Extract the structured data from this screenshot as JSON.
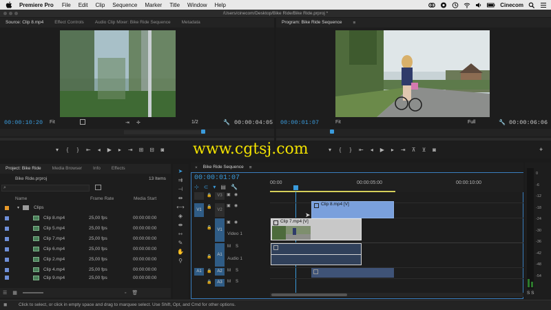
{
  "menubar": {
    "app_name": "Premiere Pro",
    "menus": [
      "File",
      "Edit",
      "Clip",
      "Sequence",
      "Marker",
      "Title",
      "Window",
      "Help"
    ],
    "user": "Cinecom"
  },
  "window": {
    "title": "/Users/cinecom/Desktop/Bike Ride/Bike Ride.prproj *"
  },
  "source_panel": {
    "tabs": [
      "Source: Clip 8.mp4",
      "Effect Controls",
      "Audio Clip Mixer: Bike Ride Sequence",
      "Metadata"
    ],
    "timecode": "00:00:10:20",
    "fit": "Fit",
    "resolution": "1/2",
    "duration": "00:00:04:05"
  },
  "program_panel": {
    "tab": "Program: Bike Ride Sequence",
    "timecode": "00:00:01:07",
    "fit": "Fit",
    "resolution": "Full",
    "duration": "00:00:06:06"
  },
  "watermark": "www.cgtsj.com",
  "project_panel": {
    "tabs": [
      "Project: Bike Ride",
      "Media Browser",
      "Info",
      "Effects"
    ],
    "file": "Bike Ride.prproj",
    "item_count": "13 Items",
    "columns": [
      "Name",
      "Frame Rate",
      "Media Start"
    ],
    "folder": "Clips",
    "clips": [
      {
        "name": "Clip 8.mp4",
        "fps": "25,00 fps",
        "start": "00:00:00:00"
      },
      {
        "name": "Clip 5.mp4",
        "fps": "25,00 fps",
        "start": "00:00:00:00"
      },
      {
        "name": "Clip 7.mp4",
        "fps": "25,00 fps",
        "start": "00:00:00:00"
      },
      {
        "name": "Clip 6.mp4",
        "fps": "25,00 fps",
        "start": "00:00:00:00"
      },
      {
        "name": "Clip 2.mp4",
        "fps": "25,00 fps",
        "start": "00:00:00:00"
      },
      {
        "name": "Clip 4.mp4",
        "fps": "25,00 fps",
        "start": "00:00:00:00"
      },
      {
        "name": "Clip 9.mp4",
        "fps": "25,00 fps",
        "start": "00:00:00:00"
      }
    ]
  },
  "timeline": {
    "tab": "Bike Ride Sequence",
    "timecode": "00:00:01:07",
    "ruler": [
      "00:00",
      "00:00:05:00",
      "00:00:10:00"
    ],
    "tracks": {
      "v3": "V3",
      "v2": "V2",
      "v1": "V1",
      "video1": "Video 1",
      "a1": "A1",
      "audio1": "Audio 1",
      "a2": "A2",
      "a3": "A3",
      "source_v1": "V1",
      "source_a1": "A1",
      "m": "M",
      "s": "S"
    },
    "clips": {
      "clip8": "Clip 8.mp4 [V]",
      "clip7": "Clip 7.mp4 [V]"
    }
  },
  "meter": {
    "labels": [
      "0",
      "-6",
      "-12",
      "-18",
      "-24",
      "-30",
      "-36",
      "-42",
      "-48",
      "-54"
    ],
    "footer": "S S"
  },
  "status": "Click to select, or click in empty space and drag to marquee select. Use Shift, Opt, and Cmd for other options."
}
